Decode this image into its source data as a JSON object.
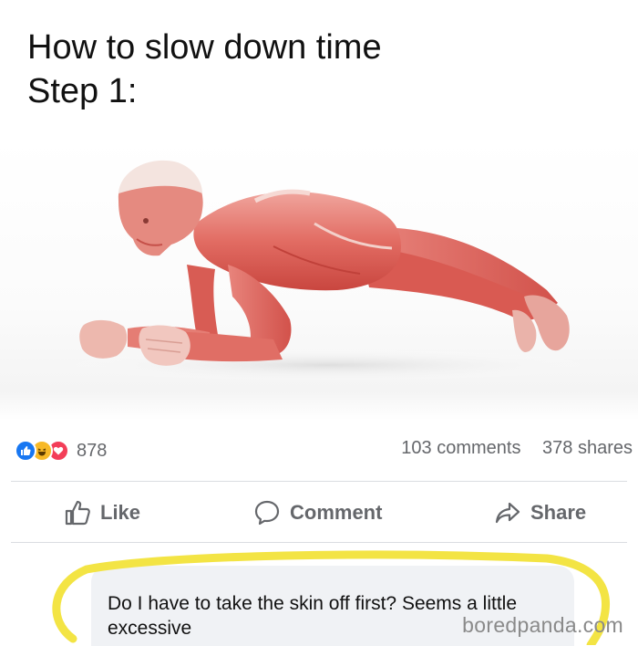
{
  "caption": {
    "line1": "How to slow down time",
    "line2": "Step 1:"
  },
  "post": {
    "reactions": {
      "icons": [
        "like-reaction-icon",
        "haha-reaction-icon",
        "love-reaction-icon"
      ],
      "count": "878"
    },
    "comments_count": "103 comments",
    "shares_count": "378 shares",
    "actions": {
      "like_label": "Like",
      "comment_label": "Comment",
      "share_label": "Share"
    }
  },
  "comment": {
    "text": "Do I have to take the skin off first? Seems a little excessive"
  },
  "watermark": "boredpanda.com",
  "colors": {
    "like_blue": "#1877f2",
    "haha_yellow": "#f7b928",
    "love_red": "#f33e58",
    "muted_text": "#65676b",
    "highlight_yellow": "#f2e33a",
    "muscle_red": "#e05a55"
  }
}
